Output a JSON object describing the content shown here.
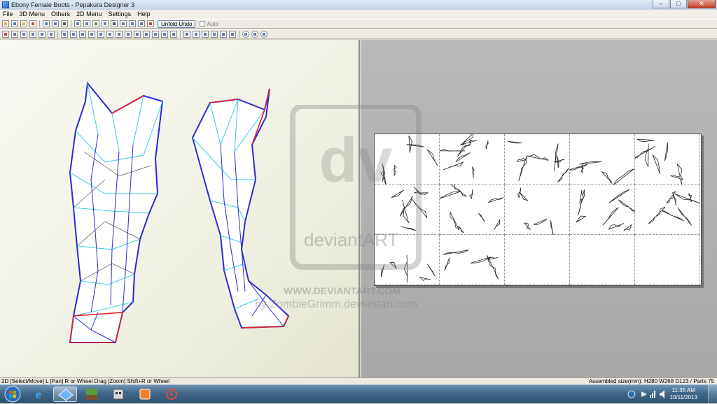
{
  "window": {
    "title": "Ebony Female Boots - Pepakura Designer 3",
    "minimize": "–",
    "maximize": "□",
    "close": "✕"
  },
  "menu": [
    "File",
    "3D Menu",
    "Others",
    "2D Menu",
    "Settings",
    "Help"
  ],
  "toolbar": {
    "unfold_undo": "Unfold Undo",
    "auto": "Auto"
  },
  "watermark": {
    "site": "deviantART",
    "url": "WWW.DEVIANTART.COM",
    "credit": "by ZombieGrimm.deviantart.com"
  },
  "status": {
    "left": "2D [Select/Move] L [Pan] R or Wheel Drag [Zoom] Shift+R or Wheel",
    "right": "Assembled size(mm): H280 W268 D123 / Parts 75"
  },
  "clock": {
    "time": "11:35 AM",
    "date": "10/11/2013"
  },
  "colors": {
    "edge_blue": "#2b2bd0",
    "edge_cyan": "#3cc8e8",
    "edge_red": "#e0202a"
  }
}
